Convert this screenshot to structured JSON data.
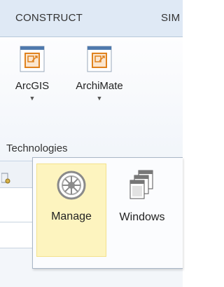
{
  "tabs": [
    {
      "label": "CONSTRUCT"
    },
    {
      "label": "SIM"
    }
  ],
  "ribbon": {
    "buttons": [
      {
        "label": "ArcGIS",
        "icon": "arcgis-icon"
      },
      {
        "label": "ArchiMate",
        "icon": "archimate-icon"
      }
    ],
    "group_label": "Technologies"
  },
  "popup": {
    "items": [
      {
        "label": "Manage",
        "icon": "wheel-icon",
        "hovered": true
      },
      {
        "label": "Windows",
        "icon": "windows-stack-icon",
        "hovered": false
      }
    ]
  },
  "colors": {
    "tab_strip": "#dfe9f5",
    "hover_fill": "#fdf4bf",
    "hover_border": "#f3e18c",
    "icon_orange": "#e0821e",
    "icon_blue": "#5b84b6"
  }
}
